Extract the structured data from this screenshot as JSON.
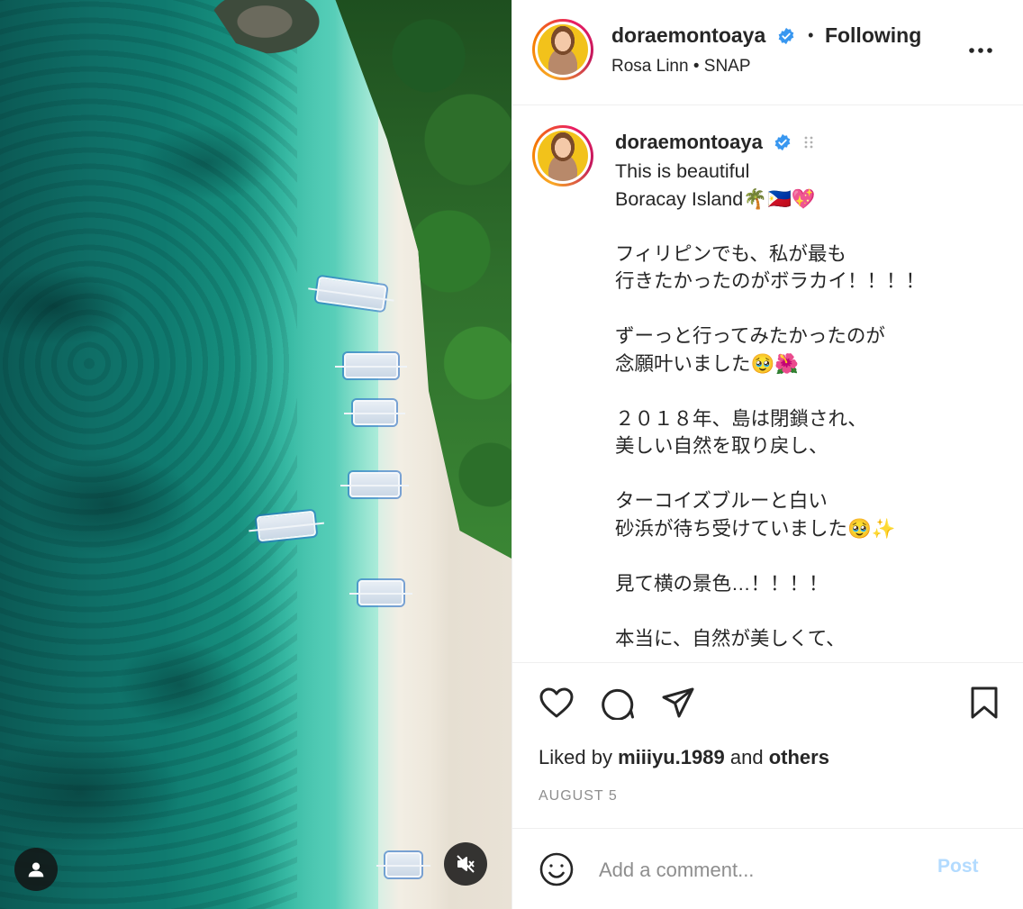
{
  "header": {
    "username": "doraemontoaya",
    "separator": "•",
    "follow_status": "Following",
    "subtitle": "Rosa Linn • SNAP",
    "more_icon": "more-horizontal-icon"
  },
  "caption": {
    "username": "doraemontoaya",
    "text": "This is beautiful\nBoracay Island🌴🇵🇭💖\n\nフィリピンでも、私が最も\n行きたかったのがボラカイ！！！！\n\nずーっと行ってみたかったのが\n念願叶いました🥹🌺\n\n２０１８年、島は閉鎖され、\n美しい自然を取り戻し、\n\nターコイズブルーと白い\n砂浜が待ち受けていました🥹✨\n\n見て横の景色…！！！！\n\n本当に、自然が美しくて、"
  },
  "likes": {
    "prefix": "Liked by",
    "user": "miiiyu.1989",
    "and": "and",
    "others": "others"
  },
  "date": "AUGUST 5",
  "comment": {
    "placeholder": "Add a comment...",
    "post_label": "Post"
  },
  "colors": {
    "verified": "#3897f0",
    "post_disabled": "#b3dbff",
    "muted_text": "#8e8e8e"
  },
  "icons": [
    "user-tag-icon",
    "mute-icon",
    "heart-icon",
    "comment-icon",
    "share-icon",
    "bookmark-icon",
    "emoji-icon",
    "verified-badge-icon",
    "more-horizontal-icon",
    "drag-handle-icon"
  ]
}
